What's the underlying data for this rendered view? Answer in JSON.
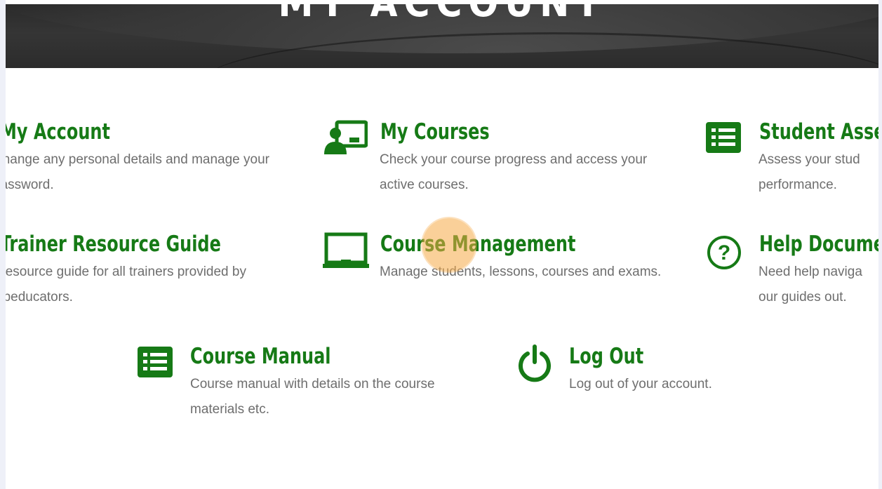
{
  "hero": {
    "title": "MY ACCOUNT"
  },
  "cards": {
    "my_account": {
      "title": "My Account",
      "desc": "Change any personal details and manage your password."
    },
    "my_courses": {
      "title": "My Courses",
      "desc": "Check your course progress and access your active courses.",
      "icon": "student-board-icon"
    },
    "student_assessment": {
      "title": "Student Asse",
      "desc": "Assess your stud performance.",
      "icon": "list-icon"
    },
    "trainer_resource": {
      "title": "Trainer Resource Guide",
      "desc": "Resource guide for all trainers provided by npeducators."
    },
    "course_management": {
      "title": "Course Management",
      "desc": "Manage students, lessons, courses and exams.",
      "icon": "laptop-icon"
    },
    "help_documents": {
      "title": "Help Docume",
      "desc": "Need help naviga our guides out.",
      "icon": "question-circle-icon"
    },
    "course_manual": {
      "title": "Course Manual",
      "desc": "Course manual with details on the course materials etc.",
      "icon": "list-icon"
    },
    "log_out": {
      "title": "Log Out",
      "desc": "Log out of your account.",
      "icon": "power-icon"
    }
  },
  "theme": {
    "accent": "#167a16",
    "text_muted": "#6e6e6e",
    "hero_bg": "#2e2e2e",
    "cursor_highlight": "#f5aa46"
  }
}
